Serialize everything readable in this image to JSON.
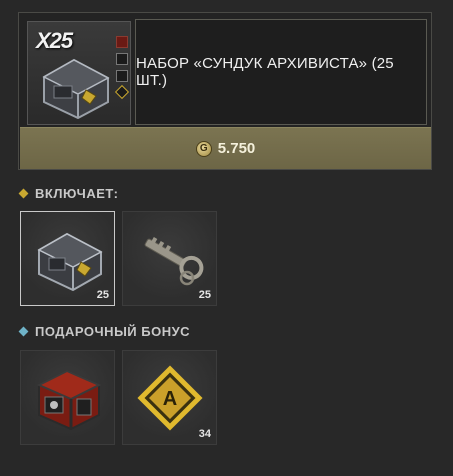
{
  "offer": {
    "quantity_badge": "X25",
    "title": "НАБОР «СУНДУК АРХИВИСТА» (25 ШТ.)",
    "price_icon": "G",
    "price": "5.750"
  },
  "includes": {
    "heading": "ВКЛЮЧАЕТ:",
    "accent": "#c9a830",
    "items": [
      {
        "icon": "archivist-chest-icon",
        "count": "25"
      },
      {
        "icon": "key-icon",
        "count": "25"
      }
    ]
  },
  "bonus": {
    "heading": "ПОДАРОЧНЫЙ БОНУС",
    "accent": "#6fb3c8",
    "items": [
      {
        "icon": "red-crate-icon",
        "count": ""
      },
      {
        "icon": "letter-a-badge-icon",
        "count": "34",
        "letter": "A"
      }
    ]
  }
}
